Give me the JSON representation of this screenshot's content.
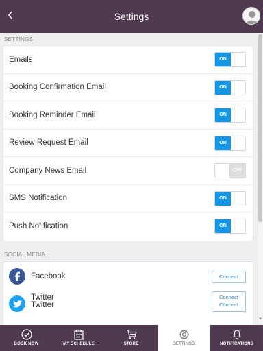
{
  "header": {
    "title": "Settings",
    "back_icon": "chevron-left-icon",
    "avatar_icon": "user-avatar-icon"
  },
  "settings": {
    "section_label": "SETTINGS",
    "items": [
      {
        "label": "Emails",
        "state": "on",
        "state_text": "ON"
      },
      {
        "label": "Booking Confirmation Email",
        "state": "on",
        "state_text": "ON"
      },
      {
        "label": "Booking Reminder Email",
        "state": "on",
        "state_text": "ON"
      },
      {
        "label": "Review Request Email",
        "state": "on",
        "state_text": "ON"
      },
      {
        "label": "Company News Email",
        "state": "off",
        "state_text": "OFF"
      },
      {
        "label": "SMS Notification",
        "state": "on",
        "state_text": "ON"
      },
      {
        "label": "Push Notification",
        "state": "on",
        "state_text": "ON"
      }
    ]
  },
  "social": {
    "section_label": "SOCIAL MEDIA",
    "items": [
      {
        "name": "Facebook",
        "button": "Connect",
        "icon": "facebook-icon",
        "color": "#3b5998"
      },
      {
        "name": "Twitter",
        "button": "Connect",
        "icon": "twitter-icon",
        "color": "#1da1f2"
      },
      {
        "name": "Twitter",
        "button": "Connect",
        "icon": "twitter-icon",
        "color": "#1da1f2"
      }
    ]
  },
  "tabbar": {
    "tabs": [
      {
        "label": "BOOK NOW",
        "icon": "check-circle-icon",
        "active": false
      },
      {
        "label": "MY SCHEDULE",
        "icon": "calendar-icon",
        "active": false
      },
      {
        "label": "STORE",
        "icon": "cart-icon",
        "active": false
      },
      {
        "label": "SETTINGS",
        "icon": "gear-icon",
        "active": true
      },
      {
        "label": "NOTIFICATIONS",
        "icon": "bell-icon",
        "active": false
      }
    ]
  },
  "colors": {
    "header_bg": "#4f3a4f",
    "toggle_on": "#1496e4",
    "toggle_off": "#dedede",
    "connect_text": "#3d87b5"
  }
}
